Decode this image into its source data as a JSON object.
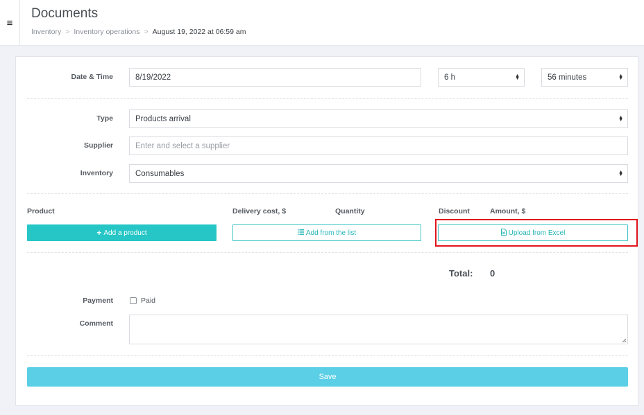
{
  "header": {
    "title": "Documents",
    "breadcrumb": [
      "Inventory",
      "Inventory operations",
      "August 19, 2022 at 06:59 am"
    ]
  },
  "form": {
    "datetime": {
      "label": "Date & Time",
      "date": "8/19/2022",
      "hour": "6 h",
      "minutes": "56 minutes"
    },
    "type": {
      "label": "Type",
      "value": "Products arrival"
    },
    "supplier": {
      "label": "Supplier",
      "placeholder": "Enter and select a supplier"
    },
    "inventory": {
      "label": "Inventory",
      "value": "Consumables"
    }
  },
  "products": {
    "columns": [
      "Product",
      "Delivery cost, $",
      "Quantity",
      "Discount",
      "Amount, $"
    ],
    "add_product_label": "Add a product",
    "add_from_list_label": "Add from the list",
    "upload_excel_label": "Upload from Excel"
  },
  "total": {
    "label": "Total:",
    "value": "0"
  },
  "payment": {
    "label": "Payment",
    "paid_label": "Paid"
  },
  "comment": {
    "label": "Comment"
  },
  "save_label": "Save",
  "colors": {
    "accent": "#26c6c6",
    "save": "#5bcfe6",
    "highlight": "#e0141b"
  },
  "icons": [
    "menu-icon",
    "plus-icon",
    "list-icon",
    "file-excel-icon"
  ]
}
